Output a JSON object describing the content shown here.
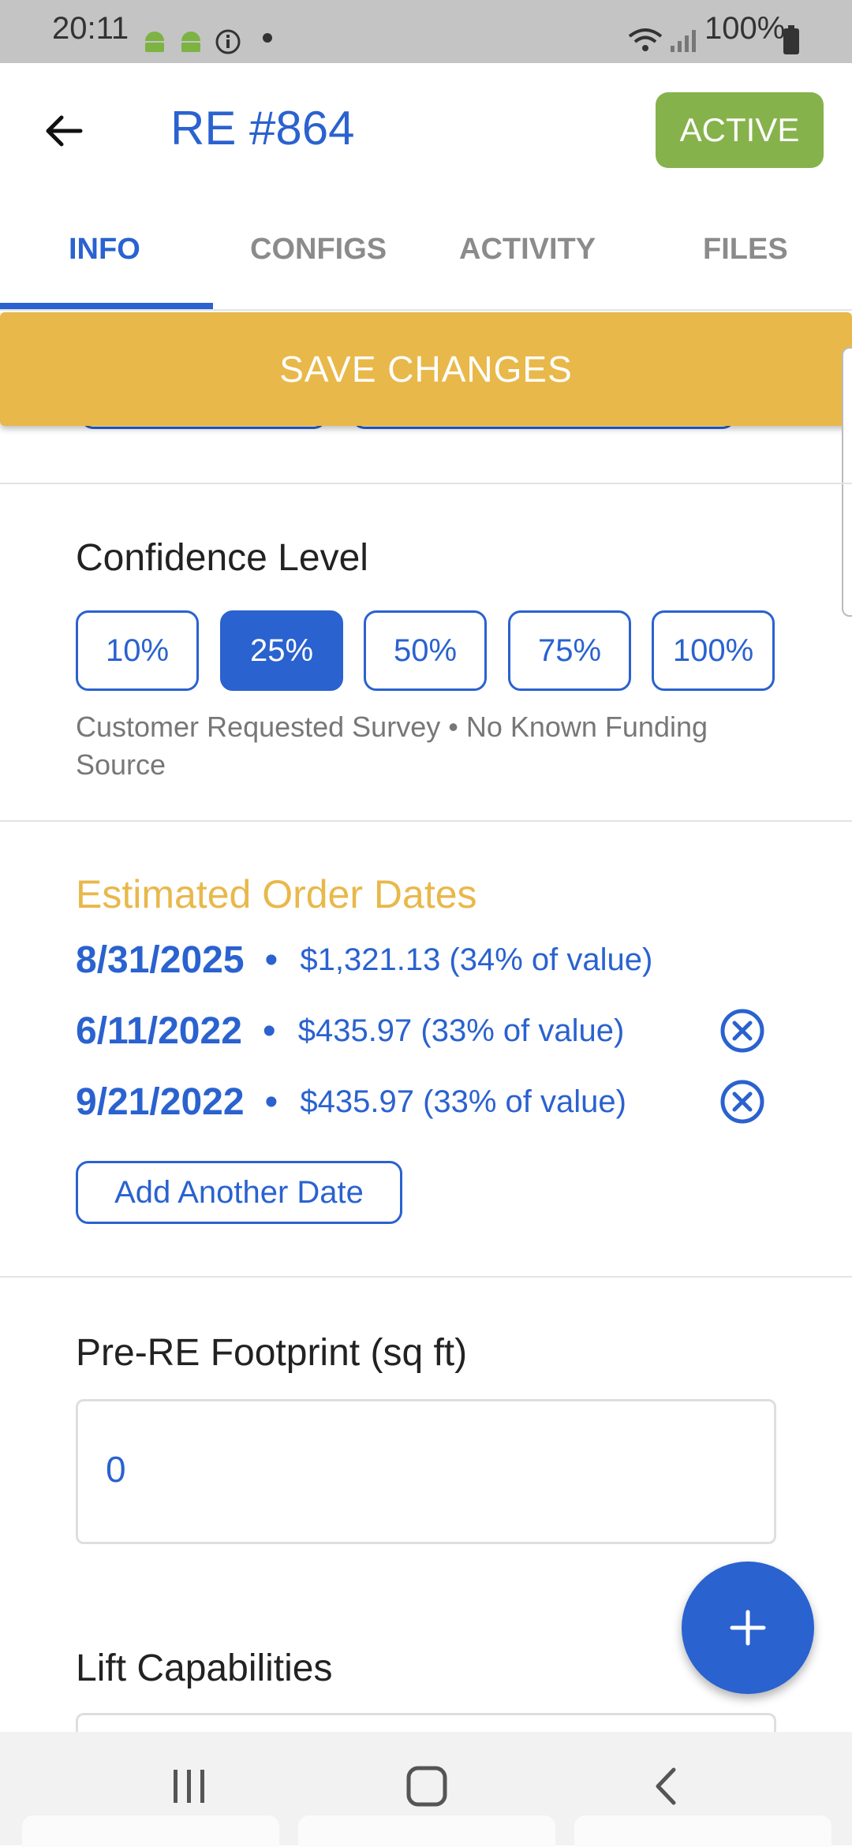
{
  "status_bar": {
    "time": "20:11",
    "battery": "100%",
    "icons": [
      "android-icon",
      "android-icon",
      "info-icon",
      "wifi-icon",
      "signal-icon",
      "battery-icon"
    ]
  },
  "header": {
    "title": "RE #864",
    "status_badge": "ACTIVE",
    "badge_color": "#86b24c",
    "accent": "#2a62cf"
  },
  "tabs": [
    {
      "label": "INFO",
      "active": true
    },
    {
      "label": "CONFIGS",
      "active": false
    },
    {
      "label": "ACTIVITY",
      "active": false
    },
    {
      "label": "FILES",
      "active": false
    }
  ],
  "save_label": "SAVE CHANGES",
  "save_color": "#e8b84a",
  "confidence": {
    "title": "Confidence Level",
    "options": [
      "10%",
      "25%",
      "50%",
      "75%",
      "100%"
    ],
    "selected": "25%",
    "description": "Customer Requested Survey • No Known Funding Source"
  },
  "estimated_order_dates": {
    "title": "Estimated Order Dates",
    "rows": [
      {
        "date": "8/31/2025",
        "separator": "•",
        "amount": "$1,321.13 (34% of value)",
        "removable": false
      },
      {
        "date": "6/11/2022",
        "separator": "•",
        "amount": "$435.97 (33% of value)",
        "removable": true
      },
      {
        "date": "9/21/2022",
        "separator": "•",
        "amount": "$435.97 (33% of value)",
        "removable": true
      }
    ],
    "add_label": "Add Another Date"
  },
  "footprint": {
    "label": "Pre-RE Footprint (sq ft)",
    "value": "0"
  },
  "lift": {
    "label": "Lift Capabilities"
  },
  "fab_icon": "plus-icon",
  "nav_icons": [
    "recent-apps-icon",
    "home-icon",
    "back-nav-icon"
  ]
}
